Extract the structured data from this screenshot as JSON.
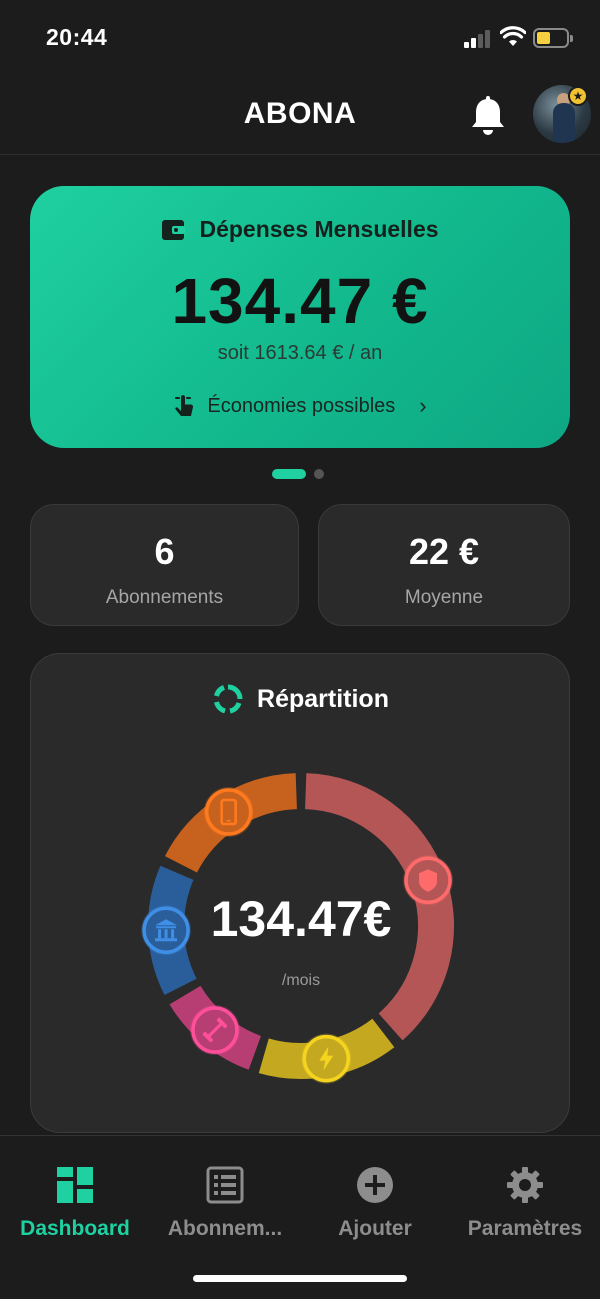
{
  "status_bar": {
    "time": "20:44"
  },
  "header": {
    "title": "ABONA"
  },
  "expenses_card": {
    "title": "Dépenses Mensuelles",
    "amount": "134.47 €",
    "per_year": "soit 1613.64 € / an",
    "savings_link": "Économies possibles",
    "accent_color": "#1fd0a0"
  },
  "stats": {
    "subscriptions_value": "6",
    "subscriptions_label": "Abonnements",
    "average_value": "22 €",
    "average_label": "Moyenne"
  },
  "repartition": {
    "title": "Répartition",
    "total": "134.47€",
    "unit": "/mois",
    "segments": [
      {
        "icon": "shield-icon",
        "color": "#b45656",
        "glow": "#ff6a6a",
        "share": 0.39
      },
      {
        "icon": "bolt-icon",
        "color": "#c4a81f",
        "glow": "#f5d41f",
        "share": 0.16
      },
      {
        "icon": "dumbbell-icon",
        "color": "#b73e73",
        "glow": "#ff4f9a",
        "share": 0.12
      },
      {
        "icon": "bank-icon",
        "color": "#2a5e9a",
        "glow": "#3f8fe6",
        "share": 0.15
      },
      {
        "icon": "phone-icon",
        "color": "#c7621e",
        "glow": "#ff7a1f",
        "share": 0.18
      }
    ]
  },
  "tab_bar": {
    "tabs": [
      {
        "label": "Dashboard",
        "active": true
      },
      {
        "label": "Abonnem...",
        "active": false
      },
      {
        "label": "Ajouter",
        "active": false
      },
      {
        "label": "Paramètres",
        "active": false
      }
    ]
  }
}
